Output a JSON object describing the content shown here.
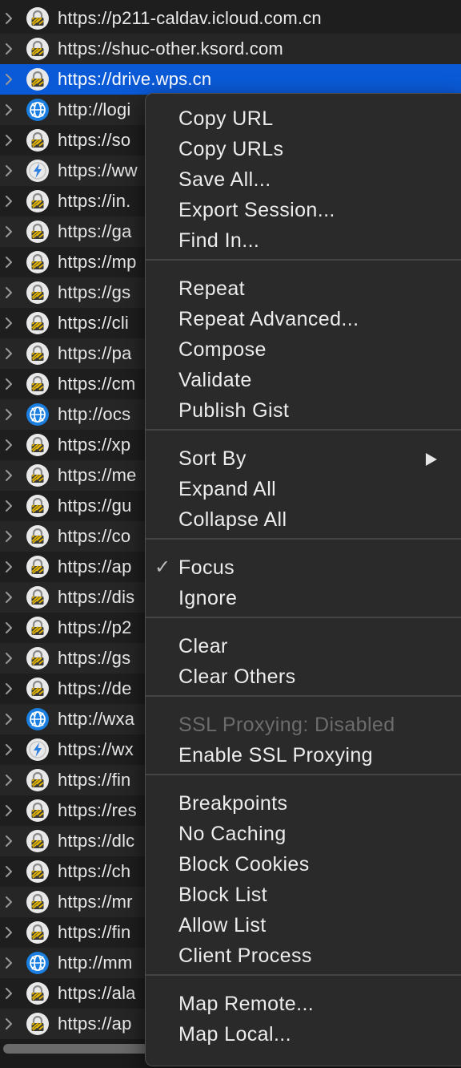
{
  "rows": [
    {
      "url": "https://p211-caldav.icloud.com.cn",
      "icon": "lock-icon"
    },
    {
      "url": "https://shuc-other.ksord.com",
      "icon": "lock-icon"
    },
    {
      "url": "https://drive.wps.cn",
      "icon": "lock-icon",
      "selected": true
    },
    {
      "url": "http://logi",
      "icon": "globe-icon"
    },
    {
      "url": "https://so",
      "icon": "lock-icon"
    },
    {
      "url": "https://ww",
      "icon": "lightning-icon"
    },
    {
      "url": "https://in.",
      "icon": "lock-icon"
    },
    {
      "url": "https://ga",
      "icon": "lock-icon"
    },
    {
      "url": "https://mp",
      "icon": "lock-icon"
    },
    {
      "url": "https://gs",
      "icon": "lock-icon"
    },
    {
      "url": "https://cli",
      "icon": "lock-icon"
    },
    {
      "url": "https://pa",
      "icon": "lock-icon"
    },
    {
      "url": "https://cm",
      "icon": "lock-icon"
    },
    {
      "url": "http://ocs",
      "icon": "globe-icon"
    },
    {
      "url": "https://xp",
      "icon": "lock-icon"
    },
    {
      "url": "https://me",
      "icon": "lock-icon"
    },
    {
      "url": "https://gu",
      "icon": "lock-icon"
    },
    {
      "url": "https://co",
      "icon": "lock-icon"
    },
    {
      "url": "https://ap",
      "icon": "lock-icon"
    },
    {
      "url": "https://dis",
      "icon": "lock-icon"
    },
    {
      "url": "https://p2",
      "icon": "lock-icon"
    },
    {
      "url": "https://gs",
      "icon": "lock-icon"
    },
    {
      "url": "https://de",
      "icon": "lock-icon"
    },
    {
      "url": "http://wxa",
      "icon": "globe-icon"
    },
    {
      "url": "https://wx",
      "icon": "lightning-icon"
    },
    {
      "url": "https://fin",
      "icon": "lock-icon"
    },
    {
      "url": "https://res",
      "icon": "lock-icon"
    },
    {
      "url": "https://dlc",
      "icon": "lock-icon"
    },
    {
      "url": "https://ch",
      "icon": "lock-icon"
    },
    {
      "url": "https://mr",
      "icon": "lock-icon"
    },
    {
      "url": "https://fin",
      "icon": "lock-icon"
    },
    {
      "url": "http://mm",
      "icon": "globe-icon"
    },
    {
      "url": "https://ala",
      "icon": "lock-icon"
    },
    {
      "url": "https://ap",
      "icon": "lock-icon"
    }
  ],
  "menu": {
    "groups": [
      [
        {
          "label": "Copy URL",
          "name": "copy-url"
        },
        {
          "label": "Copy URLs",
          "name": "copy-urls"
        },
        {
          "label": "Save All...",
          "name": "save-all"
        },
        {
          "label": "Export Session...",
          "name": "export-session"
        },
        {
          "label": "Find In...",
          "name": "find-in"
        }
      ],
      [
        {
          "label": "Repeat",
          "name": "repeat"
        },
        {
          "label": "Repeat Advanced...",
          "name": "repeat-advanced"
        },
        {
          "label": "Compose",
          "name": "compose"
        },
        {
          "label": "Validate",
          "name": "validate"
        },
        {
          "label": "Publish Gist",
          "name": "publish-gist"
        }
      ],
      [
        {
          "label": "Sort By",
          "name": "sort-by",
          "submenu": true
        },
        {
          "label": "Expand All",
          "name": "expand-all"
        },
        {
          "label": "Collapse All",
          "name": "collapse-all"
        }
      ],
      [
        {
          "label": "Focus",
          "name": "focus",
          "checked": true
        },
        {
          "label": "Ignore",
          "name": "ignore"
        }
      ],
      [
        {
          "label": "Clear",
          "name": "clear"
        },
        {
          "label": "Clear Others",
          "name": "clear-others"
        }
      ],
      [
        {
          "label": "SSL Proxying: Disabled",
          "name": "ssl-proxying-status",
          "disabled": true
        },
        {
          "label": "Enable SSL Proxying",
          "name": "enable-ssl-proxying"
        }
      ],
      [
        {
          "label": "Breakpoints",
          "name": "breakpoints"
        },
        {
          "label": "No Caching",
          "name": "no-caching"
        },
        {
          "label": "Block Cookies",
          "name": "block-cookies"
        },
        {
          "label": "Block List",
          "name": "block-list"
        },
        {
          "label": "Allow List",
          "name": "allow-list"
        },
        {
          "label": "Client Process",
          "name": "client-process"
        }
      ],
      [
        {
          "label": "Map Remote...",
          "name": "map-remote"
        },
        {
          "label": "Map Local...",
          "name": "map-local"
        }
      ]
    ],
    "check_glyph": "✓"
  },
  "colors": {
    "selection": "#0a5ad8",
    "menu_bg": "#2a2a2b",
    "globe_blue": "#1a7fe0"
  }
}
